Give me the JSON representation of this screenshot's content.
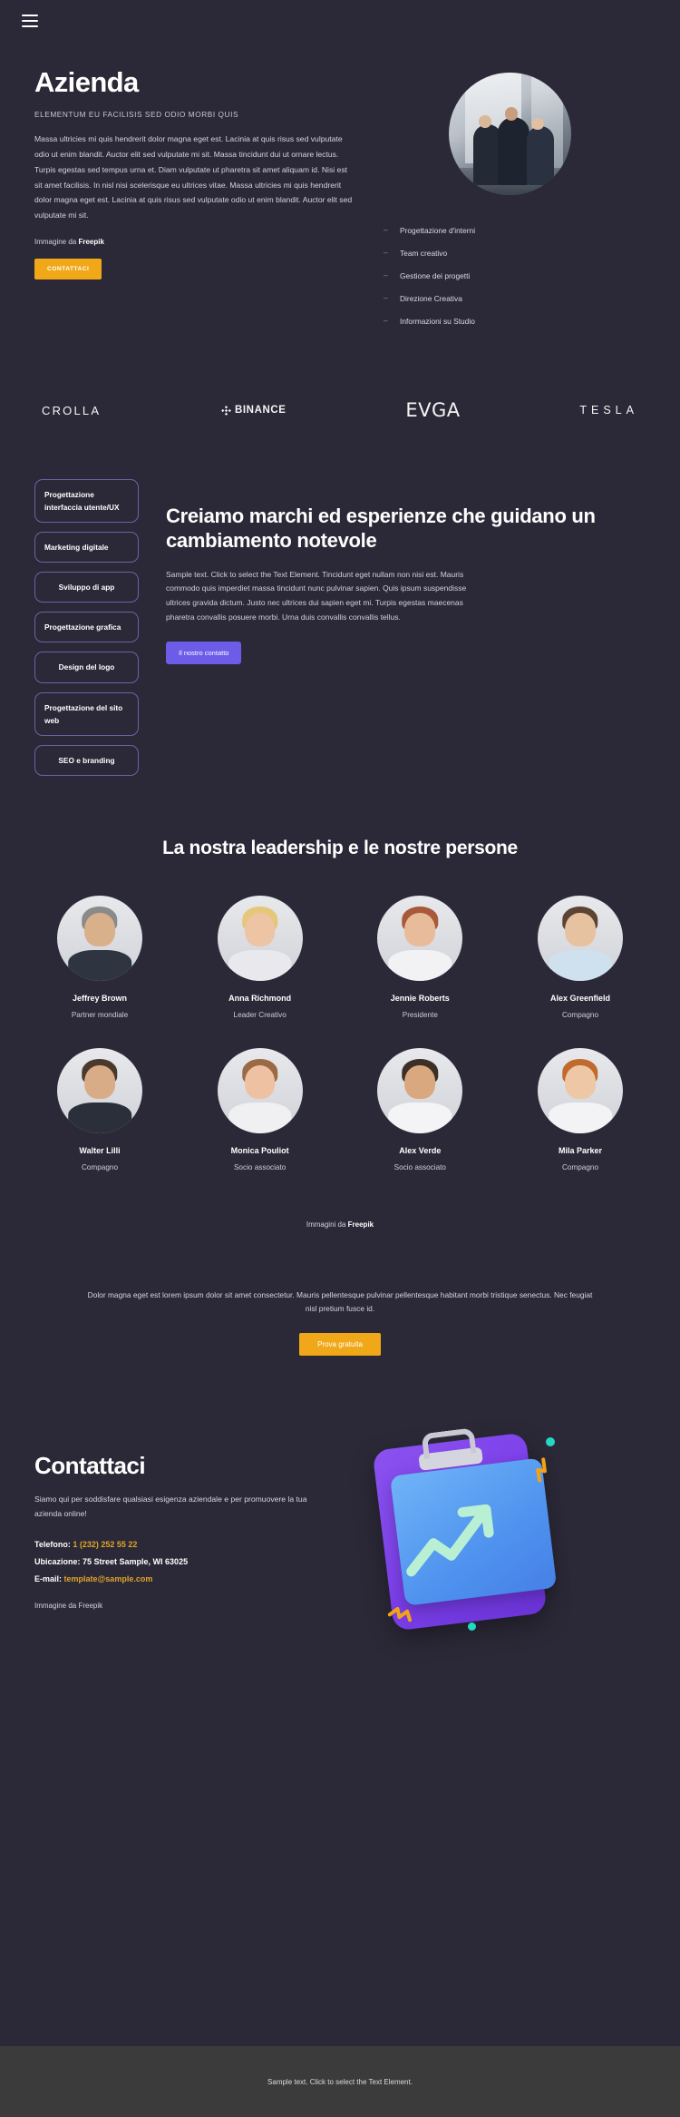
{
  "header": {
    "menu_icon": "hamburger-menu-icon"
  },
  "hero": {
    "title": "Azienda",
    "kicker": "ELEMENTUM EU FACILISIS SED ODIO MORBI QUIS",
    "body": "Massa ultricies mi quis hendrerit dolor magna eget est. Lacinia at quis risus sed vulputate odio ut enim blandit. Auctor elit sed vulputate mi sit. Massa tincidunt dui ut ornare lectus. Turpis egestas sed tempus urna et. Diam vulputate ut pharetra sit amet aliquam id. Nisi est sit amet facilisis. In nisl nisi scelerisque eu ultrices vitae. Massa ultricies mi quis hendrerit dolor magna eget est. Lacinia at quis risus sed vulputate odio ut enim blandit. Auctor elit sed vulputate mi sit.",
    "credit_prefix": "Immagine da ",
    "credit_brand": "Freepik",
    "cta_label": "CONTATTACI",
    "photo_alt": "business-team-photo",
    "services": [
      "Progettazione d'interni",
      "Team creativo",
      "Gestione dei progetti",
      "Direzione Creativa",
      "Informazioni su Studio"
    ]
  },
  "brands": [
    {
      "name": "CROLLA",
      "key": "crolla"
    },
    {
      "name": "BINANCE",
      "key": "binance"
    },
    {
      "name": "EVGA",
      "key": "evga"
    },
    {
      "name": "TESLA",
      "key": "tesla"
    }
  ],
  "services_section": {
    "pills": [
      "Progettazione interfaccia utente/UX",
      "Marketing digitale",
      "Sviluppo di app",
      "Progettazione grafica",
      "Design del logo",
      "Progettazione del sito web",
      "SEO e branding"
    ],
    "title": "Creiamo marchi ed esperienze che guidano un cambiamento notevole",
    "body": "Sample text. Click to select the Text Element. Tincidunt eget nullam non nisi est. Mauris commodo quis imperdiet massa tincidunt nunc pulvinar sapien. Quis ipsum suspendisse ultrices gravida dictum. Justo nec ultrices dui sapien eget mi. Turpis egestas maecenas pharetra convallis posuere morbi. Urna duis convallis convallis tellus.",
    "cta_label": "Il nostro contatto"
  },
  "team": {
    "title": "La nostra leadership e le nostre persone",
    "credit_prefix": "Immagini da ",
    "credit_brand": "Freepik",
    "members": [
      {
        "name": "Jeffrey Brown",
        "role": "Partner mondiale",
        "skin": "#d8b08a",
        "hair": "#8a8a8a",
        "shirt": "#2e3440"
      },
      {
        "name": "Anna Richmond",
        "role": "Leader Creativo",
        "skin": "#edc4a4",
        "hair": "#e5c77a",
        "shirt": "#e9e9ed"
      },
      {
        "name": "Jennie Roberts",
        "role": "Presidente",
        "skin": "#e8bb9a",
        "hair": "#a8593a",
        "shirt": "#f2f2f4"
      },
      {
        "name": "Alex Greenfield",
        "role": "Compagno",
        "skin": "#e7c2a1",
        "hair": "#5c4434",
        "shirt": "#cfe0ee"
      },
      {
        "name": "Walter Lilli",
        "role": "Compagno",
        "skin": "#d8ac86",
        "hair": "#4a3a2c",
        "shirt": "#2b2f3a"
      },
      {
        "name": "Monica Pouliot",
        "role": "Socio associato",
        "skin": "#edc1a2",
        "hair": "#9a6a44",
        "shirt": "#f0f0f2"
      },
      {
        "name": "Alex Verde",
        "role": "Socio associato",
        "skin": "#d9a87e",
        "hair": "#3b2f26",
        "shirt": "#f4f4f6"
      },
      {
        "name": "Mila Parker",
        "role": "Compagno",
        "skin": "#eec7a6",
        "hair": "#c06a2e",
        "shirt": "#f3f3f5"
      }
    ]
  },
  "cta_section": {
    "text": "Dolor magna eget est lorem ipsum dolor sit amet consectetur. Mauris pellentesque pulvinar pellentesque habitant morbi tristique senectus. Nec feugiat nisl pretium fusce id.",
    "button_label": "Prova gratuita"
  },
  "contact": {
    "title": "Contattaci",
    "body": "Siamo qui per soddisfare qualsiasi esigenza aziendale e per promuovere la tua azienda online!",
    "phone_label": "Telefono: ",
    "phone_value": "1 (232) 252 55 22",
    "location_label": "Ubicazione: ",
    "location_value": "75 Street Sample, WI 63025",
    "email_label": "E-mail: ",
    "email_value": "template@sample.com",
    "credit": "Immagine da Freepik",
    "illustration_alt": "clipboard-growth-chart-illustration"
  },
  "footer": {
    "text": "Sample text. Click to select the Text Element."
  },
  "colors": {
    "background": "#2b2937",
    "accent_yellow": "#f0a818",
    "accent_purple": "#6c5ce7",
    "pill_border": "#6c62a6",
    "gold_text": "#e0a429",
    "footer_bg": "#3b3b3b"
  }
}
